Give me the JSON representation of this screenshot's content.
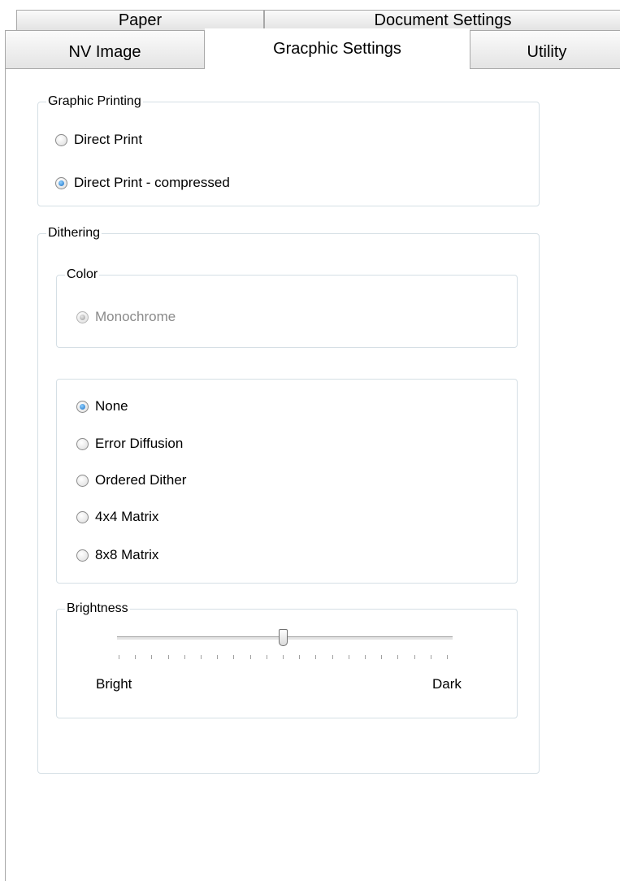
{
  "tabs": {
    "paper": "Paper",
    "document_settings": "Document Settings",
    "nv_image": "NV Image",
    "graphic_settings": "Gracphic Settings",
    "utility": "Utility"
  },
  "graphic_printing": {
    "legend": "Graphic Printing",
    "options": [
      "Direct Print",
      "Direct Print - compressed"
    ],
    "selected": "Direct Print - compressed"
  },
  "dithering": {
    "legend": "Dithering",
    "color": {
      "legend": "Color",
      "option": "Monochrome",
      "state": "disabled, selected"
    },
    "methods": {
      "options": [
        "None",
        "Error Diffusion",
        "Ordered Dither",
        "4x4 Matrix",
        "8x8 Matrix"
      ],
      "selected": "None"
    },
    "brightness": {
      "legend": "Brightness",
      "min_label": "Bright",
      "max_label": "Dark",
      "tick_count": 21,
      "value_fraction": 0.5
    }
  }
}
